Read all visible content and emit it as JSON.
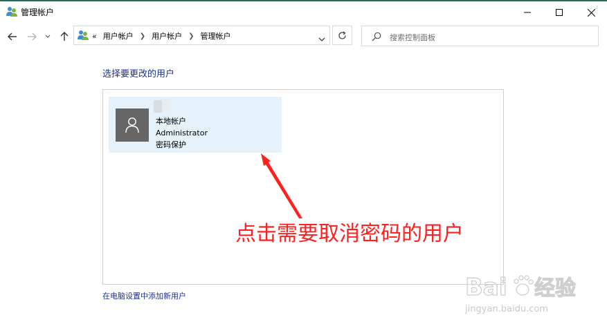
{
  "window": {
    "title": "管理帐户",
    "accent_color": "#1a6d5a"
  },
  "address_bar": {
    "prefix": "«",
    "breadcrumbs": [
      "用户帐户",
      "用户帐户",
      "管理帐户"
    ]
  },
  "search": {
    "placeholder": "搜索控制面板"
  },
  "main": {
    "heading": "选择要更改的用户",
    "user": {
      "line1": "本地帐户",
      "line2": "Administrator",
      "line3": "密码保护"
    },
    "add_user_link": "在电脑设置中添加新用户"
  },
  "annotation": {
    "text": "点击需要取消密码的用户",
    "color": "#ff2020"
  },
  "watermark": {
    "logo_text": "Bai du 经验",
    "url": "jingyan.baidu.com"
  }
}
